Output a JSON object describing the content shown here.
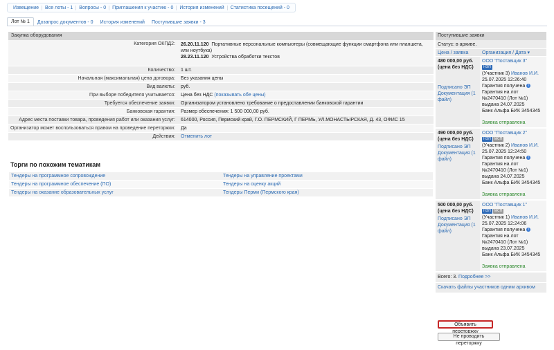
{
  "top_tabs": [
    "Извещение",
    "Все лоты - 1",
    "Вопросы - 0",
    "Приглашения к участию - 0",
    "История изменений",
    "Статистика посещений - 0"
  ],
  "sub_tabs": [
    "Лот № 1",
    "Дозапрос документов - 0",
    "История изменений",
    "Поступившие заявки - 3"
  ],
  "lot": {
    "header": "Закупка оборудования",
    "okpd_label": "Категория ОКПД2:",
    "okpd1_code": "26.20.11.120",
    "okpd1_text": "Портативные персональные компьютеры (совмещающие функции смартфона или планшета, или ноутбука)",
    "okpd2_code": "28.23.11.120",
    "okpd2_text": "Устройства обработки текстов",
    "qty_label": "Количество:",
    "qty": "1 шт.",
    "price_label": "Начальная (максимальная) цена договора:",
    "price": "Без указания цены",
    "currency_label": "Вид валюты:",
    "currency": "руб.",
    "winner_label": "При выборе победителя учитывается:",
    "winner": "Цена без НДС",
    "winner_link": "(показывать обе цены)",
    "security_label": "Требуется обеспечение заявки:",
    "security": "Организатором установлено требование о предоставлении банковской гарантии",
    "guarantee_label": "Банковская гарантия:",
    "guarantee": "Размер обеспечения: 1 500 000,00 руб.",
    "address_label": "Адрес места поставки товара, проведения работ или оказания услуг:",
    "address": "614000, Россия, Пермский край, Г.О. ПЕРМСКИЙ, Г ПЕРМЬ, УЛ.МОНАСТЫРСКАЯ, Д. 43, ОФИС 15",
    "rebid_label": "Организатор может воспользоваться правом на проведение переторжки:",
    "rebid": "Да",
    "actions_label": "Действия:",
    "actions_link": "Отменить лот"
  },
  "similar": {
    "title": "Торги по похожим тематикам",
    "left": [
      "Тендеры на программное сопровождение",
      "Тендеры на программное обеспечение (ПО)",
      "Тендеры на оказание образовательных услуг"
    ],
    "right": [
      "Тендеры на управление проектами",
      "Тендеры на оценку акций",
      "Тендеры Перми (Пермского края)"
    ]
  },
  "bids": {
    "header": "Поступившие заявки",
    "status": "Статус: в архиве.",
    "col_price": "Цена / заявка",
    "col_org": "Организация / Дата ▾",
    "items": [
      {
        "price": "480 000,00 руб.",
        "vat": "(цена без НДС)",
        "signed": "Подписано ЭП",
        "docs": "Документация (1 файл)",
        "org": "ООО \"Поставщик 3\"",
        "badge1": "НЭП",
        "badge2": "",
        "participant": "(Участник 3)",
        "person": "Иванов И.И.",
        "date": "25.07.2025 12:26:40",
        "guarantee": "Гарантия получена",
        "g1": "Гарантия на лот",
        "g2": "№2470410 (Лот №1)",
        "g3": "выдана 24.07.2025",
        "g4": "Банк Альфа БИК 3454345",
        "sent": "Заявка отправлена"
      },
      {
        "price": "490 000,00 руб.",
        "vat": "(цена без НДС)",
        "signed": "Подписано ЭП",
        "docs": "Документация (1 файл)",
        "org": "ООО \"Поставщик 2\"",
        "badge1": "НЭП",
        "badge2": "МСП",
        "participant": "(Участник 2)",
        "person": "Иванов И.И.",
        "date": "25.07.2025 12:24:50",
        "guarantee": "Гарантия получена",
        "g1": "Гарантия на лот",
        "g2": "№2470410 (Лот №1)",
        "g3": "выдана 24.07.2025",
        "g4": "Банк Альфа БИК 3454345",
        "sent": "Заявка отправлена"
      },
      {
        "price": "500 000,00 руб.",
        "vat": "(цена без НДС)",
        "signed": "Подписано ЭП",
        "docs": "Документация (1 файл)",
        "org": "ООО \"Поставщик 1\"",
        "badge1": "НЭП",
        "badge2": "МСП",
        "participant": "(Участник 1)",
        "person": "Иванов И.И.",
        "date": "25.07.2025 12:24:06",
        "guarantee": "Гарантия получена",
        "g1": "Гарантия на лот",
        "g2": "№2470410 (Лот №1)",
        "g3": "выдана 23.07.2025",
        "g4": "Банк Альфа БИК 3454345",
        "sent": "Заявка отправлена"
      }
    ],
    "total": "Всего: 3.",
    "more": "Подробнее >>",
    "download": "Скачать файлы участников одним архивом",
    "btn_rebid": "Объявить переторжку",
    "btn_no_rebid": "Не проводить переторжку"
  }
}
